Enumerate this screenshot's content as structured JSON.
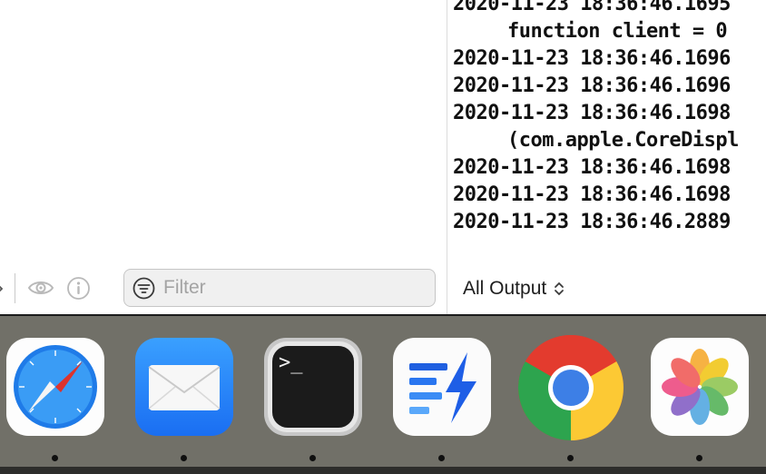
{
  "console": {
    "lines": [
      {
        "text": "2020-11-23 18:36:46.1695",
        "indent": false
      },
      {
        "text": "function client = 0",
        "indent": true
      },
      {
        "text": "2020-11-23 18:36:46.1696",
        "indent": false
      },
      {
        "text": "2020-11-23 18:36:46.1696",
        "indent": false
      },
      {
        "text": "2020-11-23 18:36:46.1698",
        "indent": false
      },
      {
        "text": "(com.apple.CoreDispl",
        "indent": true
      },
      {
        "text": "2020-11-23 18:36:46.1698",
        "indent": false
      },
      {
        "text": "2020-11-23 18:36:46.1698",
        "indent": false
      },
      {
        "text": "2020-11-23 18:36:46.2889",
        "indent": false
      }
    ]
  },
  "toolbar": {
    "filter_placeholder": "Filter",
    "output_selector": "All Output"
  },
  "dock": {
    "apps": [
      {
        "name": "Safari",
        "icon": "safari-icon",
        "running": true
      },
      {
        "name": "Mail",
        "icon": "mail-icon",
        "running": true
      },
      {
        "name": "Terminal",
        "icon": "terminal-icon",
        "running": true,
        "prompt": ">_"
      },
      {
        "name": "Toolbox",
        "icon": "toolbox-icon",
        "running": true
      },
      {
        "name": "Google Chrome",
        "icon": "chrome-icon",
        "running": true
      },
      {
        "name": "Photos",
        "icon": "photos-icon",
        "running": true
      }
    ]
  },
  "colors": {
    "dock_background": "#717068",
    "accent_blue": "#1a6ef2"
  }
}
